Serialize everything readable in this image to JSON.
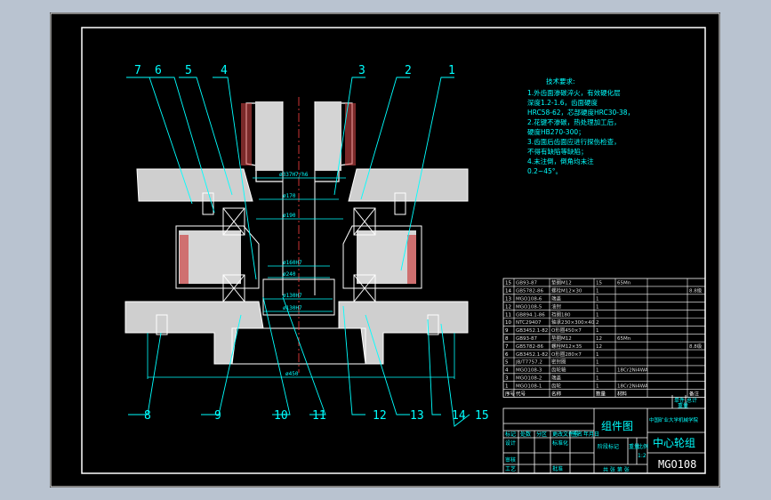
{
  "drawing": {
    "callouts": [
      "7",
      "6",
      "5",
      "4",
      "3",
      "2",
      "1",
      "8",
      "9",
      "10",
      "11",
      "12",
      "13",
      "14",
      "15"
    ],
    "tech_requirements": {
      "title": "技术要求:",
      "lines": [
        "1.外齿面渗碳淬火，有效硬化层",
        "深度1.2-1.6，齿面硬度",
        "HRC58-62，芯部硬度HRC30-38，",
        "2.花键不渗碳，热处理加工后，",
        "硬度HB270-300；",
        "3.齿面后齿面应进行探伤检查，",
        "不得有缺陷等缺陷；",
        "4.未注倒，倒角均未注",
        "0.2~45°。"
      ]
    },
    "dimensions": [
      "ø337H7/h6",
      "ø170",
      "ø190",
      "ø160H7",
      "ø240",
      "ø130H7",
      "ø130H7",
      "ø450"
    ],
    "bom_rows": [
      {
        "no": "15",
        "code": "GB93-87",
        "name": "垫圈M12",
        "qty": "15",
        "mat": "65Mn",
        "note": ""
      },
      {
        "no": "14",
        "code": "GB5782-86",
        "name": "螺栓M12×30",
        "qty": "1",
        "mat": "",
        "note": "8.8级"
      },
      {
        "no": "13",
        "code": "MGO108-6",
        "name": "端盖",
        "qty": "1",
        "mat": "",
        "note": ""
      },
      {
        "no": "12",
        "code": "MGO108-5",
        "name": "油封",
        "qty": "1",
        "mat": "",
        "note": ""
      },
      {
        "no": "11",
        "code": "GB894.1-86",
        "name": "挡圈180",
        "qty": "1",
        "mat": "",
        "note": ""
      },
      {
        "no": "10",
        "code": "NTC29407",
        "name": "轴承230×300×40",
        "qty": "2",
        "mat": "",
        "note": ""
      },
      {
        "no": "9",
        "code": "GB3452.1-82",
        "name": "O形圈450×7",
        "qty": "1",
        "mat": "",
        "note": ""
      },
      {
        "no": "8",
        "code": "GB93-87",
        "name": "垫圈M12",
        "qty": "12",
        "mat": "65Mn",
        "note": ""
      },
      {
        "no": "7",
        "code": "GB5782-86",
        "name": "螺栓M12×35",
        "qty": "12",
        "mat": "",
        "note": "8.8级"
      },
      {
        "no": "6",
        "code": "GB3452.1-82",
        "name": "O形圈280×7",
        "qty": "1",
        "mat": "",
        "note": ""
      },
      {
        "no": "5",
        "code": "JB/T7757.2",
        "name": "密封圈",
        "qty": "1",
        "mat": "",
        "note": ""
      },
      {
        "no": "4",
        "code": "MGO108-3",
        "name": "齿轮轴",
        "qty": "1",
        "mat": "18Cr2Ni4WA",
        "note": ""
      },
      {
        "no": "3",
        "code": "MGO108-2",
        "name": "端盖",
        "qty": "1",
        "mat": "",
        "note": ""
      },
      {
        "no": "1",
        "code": "MGO108-1",
        "name": "齿轮",
        "qty": "1",
        "mat": "18Cr2Ni4WA",
        "note": ""
      }
    ],
    "bom_header": [
      "序号",
      "代号",
      "名称",
      "数量",
      "材料",
      "备注"
    ],
    "weight_labels": [
      "单件",
      "总计",
      "重量"
    ],
    "title_block": {
      "assembly": "组件图",
      "school": "中国矿业大学机械学院",
      "part_name": "中心轮组",
      "drawing_no": "MGO108",
      "scale": "1:2",
      "design_row": [
        "标记",
        "处数",
        "分区",
        "更改文件号",
        "签名",
        "年月日"
      ],
      "designer_row": [
        "设计",
        "",
        "标准化"
      ],
      "stage_labels": [
        "阶段标记",
        "重量",
        "比例"
      ],
      "review_labels": [
        "审核",
        "批准"
      ],
      "process_label": "工艺",
      "sheet_label": "共 张 第 张"
    }
  }
}
